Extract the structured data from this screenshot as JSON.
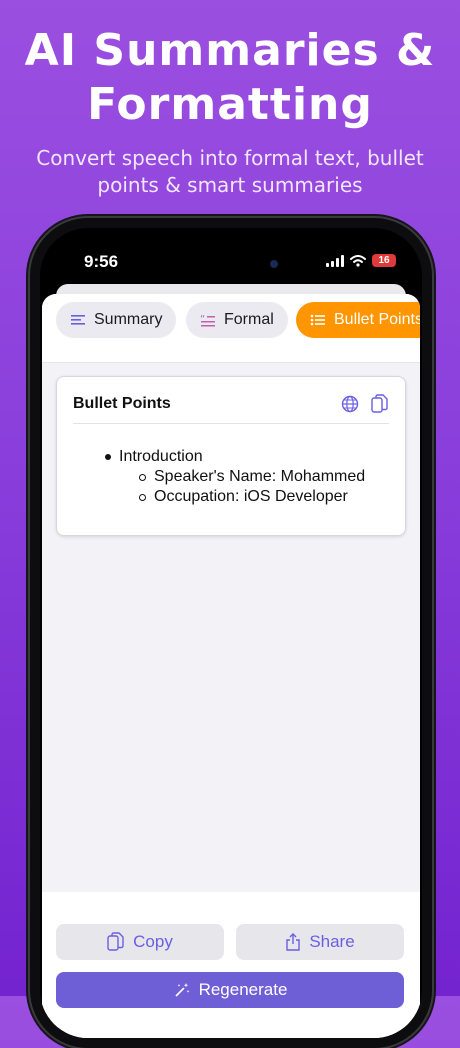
{
  "hero": {
    "title_line1": "AI Summaries &",
    "title_line2": "Formatting",
    "subtitle_line1": "Convert speech into formal text, bullet",
    "subtitle_line2": "points & smart summaries"
  },
  "status_bar": {
    "time": "9:56",
    "battery": "16"
  },
  "tabs": [
    {
      "label": "Summary",
      "icon": "text-align-icon",
      "active": false
    },
    {
      "label": "Formal",
      "icon": "quote-icon",
      "active": false
    },
    {
      "label": "Bullet Points",
      "icon": "list-bullet-icon",
      "active": true
    }
  ],
  "card": {
    "title": "Bullet Points",
    "bullets": [
      {
        "text": "Introduction",
        "children": [
          "Speaker's Name: Mohammed",
          "Occupation: iOS Developer"
        ]
      }
    ]
  },
  "actions": {
    "copy": "Copy",
    "share": "Share",
    "regenerate": "Regenerate"
  },
  "colors": {
    "accent": "#6f5fd6",
    "active_tab": "#ff9500",
    "background": "#8a3fdc"
  }
}
